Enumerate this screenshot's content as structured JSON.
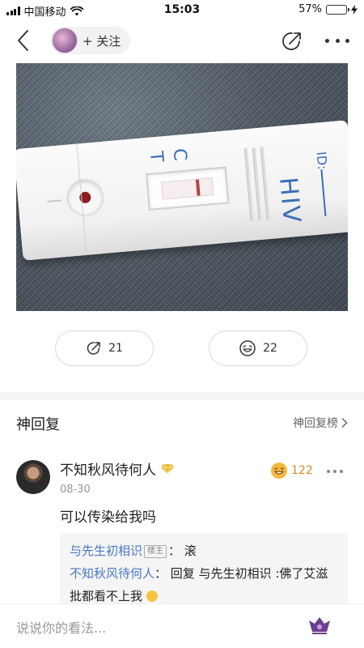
{
  "status_bar": {
    "carrier": "中国移动",
    "time": "15:03",
    "battery": "57%",
    "battery_level": 0.57
  },
  "nav": {
    "follow_label": "+ 关注"
  },
  "photo": {
    "strip_label_c": "C",
    "strip_label_t": "T",
    "strip_label_hiv": "HIV",
    "strip_label_id": "ID:"
  },
  "actions": {
    "share_count": "21",
    "like_count": "22"
  },
  "section": {
    "title": "神回复",
    "link": "神回复榜"
  },
  "comment": {
    "author": "不知秋风待何人",
    "time": "08-30",
    "likes": "122",
    "text": "可以传染给我吗",
    "replies": [
      {
        "name": "与先生初相识",
        "tag": "楼主",
        "text": "：  滚"
      },
      {
        "name": "不知秋风待何人",
        "text": "：  回复 与先生初相识 :佛了艾滋批都看不上我"
      }
    ]
  },
  "bottom": {
    "placeholder": "说说你的看法..."
  },
  "colors": {
    "accent_link": "#4a78c4",
    "like_orange": "#e0862a",
    "battery_green": "#4cd964"
  }
}
